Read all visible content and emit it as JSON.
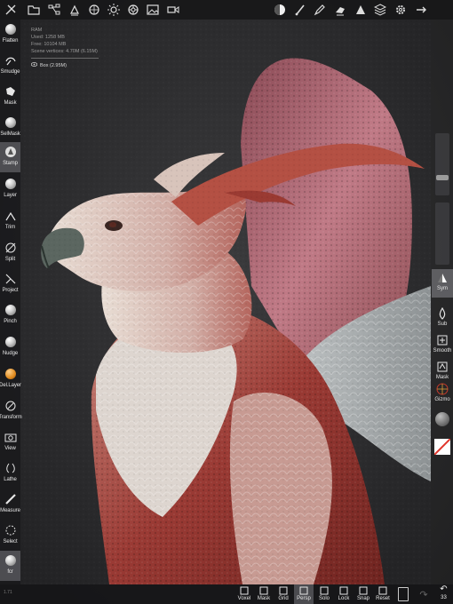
{
  "stats": {
    "ram": "RAM",
    "used": "Used: 1258 MB",
    "free": "Free: 10104 MB",
    "scene": "Scene vertices: 4.70M (6.15M)",
    "mesh": "Box (2.95M)"
  },
  "top_toolbar": {
    "icons": [
      "tools-icon",
      "folder-icon",
      "scene-graph-icon",
      "triangle-menu-icon",
      "material-icon",
      "sun-icon",
      "settings-wheel-icon",
      "image-icon",
      "video-icon",
      "material-ball-icon",
      "brush-icon",
      "pen-icon",
      "paint-icon",
      "camera-icon",
      "layers-icon",
      "gear-icon",
      "more-icon"
    ]
  },
  "left_tools": [
    {
      "label": "Flatten",
      "icon": "flatten-icon"
    },
    {
      "label": "Smudge",
      "icon": "smudge-icon"
    },
    {
      "label": "Mask",
      "icon": "mask-icon"
    },
    {
      "label": "SelMask",
      "icon": "selmask-icon"
    },
    {
      "label": "Stamp",
      "icon": "stamp-icon",
      "active": true
    },
    {
      "label": "Layer",
      "icon": "layer-icon"
    },
    {
      "label": "Trim",
      "icon": "trim-icon"
    },
    {
      "label": "Split",
      "icon": "split-icon"
    },
    {
      "label": "Project",
      "icon": "project-icon"
    },
    {
      "label": "Pinch",
      "icon": "pinch-icon"
    },
    {
      "label": "Nudge",
      "icon": "nudge-icon"
    },
    {
      "label": "Del.Layer",
      "icon": "del-layer-icon"
    },
    {
      "label": "Transform",
      "icon": "transform-icon"
    },
    {
      "label": "View",
      "icon": "view-icon"
    },
    {
      "label": "Lathe",
      "icon": "lathe-icon"
    },
    {
      "label": "Measure",
      "icon": "measure-icon"
    },
    {
      "label": "Select",
      "icon": "select-icon"
    },
    {
      "label": "fcr",
      "icon": "fcr-icon",
      "active": true
    }
  ],
  "right_tools": [
    {
      "label": "Sym",
      "icon": "symmetry-icon",
      "active": true
    },
    {
      "label": "Sub",
      "icon": "sub-icon"
    },
    {
      "label": "Smooth",
      "icon": "smooth-icon"
    },
    {
      "label": "Mask",
      "icon": "mask-toggle-icon"
    },
    {
      "label": "Gizmo",
      "icon": "gizmo-icon"
    }
  ],
  "sliders": {
    "radius_level": 0.25,
    "intensity_level": 0.5
  },
  "bottom_tools": [
    {
      "label": "Voxel",
      "icon": "voxel-icon"
    },
    {
      "label": "Mask",
      "icon": "mask-bottom-icon"
    },
    {
      "label": "Grid",
      "icon": "grid-icon"
    },
    {
      "label": "Persp",
      "icon": "perspective-icon",
      "active": true
    },
    {
      "label": "Solo",
      "icon": "solo-icon"
    },
    {
      "label": "Lock",
      "icon": "lock-icon"
    },
    {
      "label": "Snap",
      "icon": "snap-icon"
    },
    {
      "label": "Reset",
      "icon": "reset-icon"
    }
  ],
  "undo": {
    "count": "33",
    "icon": "undo-icon"
  },
  "version": "1.71",
  "colors": {
    "accent_orange": "#e08a1e",
    "model_red": "#a0403e",
    "model_white": "#d9d2cc"
  }
}
